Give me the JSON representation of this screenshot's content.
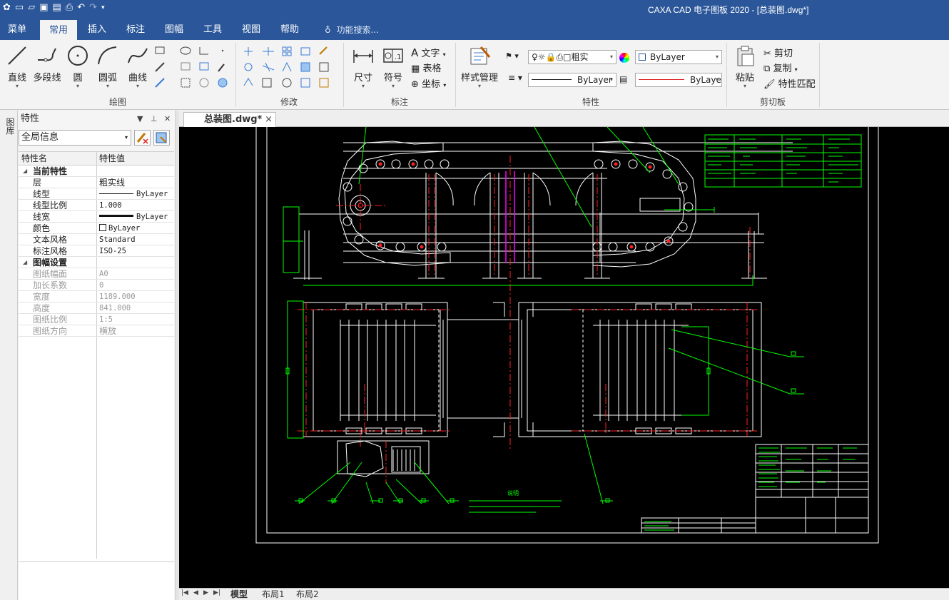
{
  "window": {
    "title": "CAXA CAD 电子图板 2020 - [总装图.dwg*]"
  },
  "quick_access": [
    "app-icon",
    "new-icon",
    "open-icon",
    "save-icon",
    "saveas-icon",
    "print-icon",
    "undo-icon",
    "redo-icon",
    "customize-icon"
  ],
  "menu": {
    "tabs": [
      "菜单",
      "常用",
      "插入",
      "标注",
      "图幅",
      "工具",
      "视图",
      "帮助"
    ],
    "active_tab": "常用",
    "search_placeholder": "功能搜索..."
  },
  "ribbon": {
    "draw": {
      "label": "绘图",
      "buttons": [
        "直线",
        "多段线",
        "圆",
        "圆弧",
        "曲线"
      ]
    },
    "modify": {
      "label": "修改"
    },
    "annotate": {
      "label": "标注",
      "buttons": [
        "尺寸",
        "符号"
      ],
      "small": [
        "文字",
        "表格",
        "坐标"
      ]
    },
    "props": {
      "label": "特性",
      "style_button": "样式管理",
      "layer_text": "粗实",
      "color_combo": "ByLayer",
      "linetype_combo": "ByLayer",
      "lineweight_combo": "ByLaye"
    },
    "clipboard": {
      "label": "剪切板",
      "paste": "粘贴",
      "cut": "剪切",
      "copy": "复制",
      "match": "特性匹配"
    }
  },
  "side_strip_label": "图库",
  "properties_panel": {
    "title": "特性",
    "selector": "全局信息",
    "col_name": "特性名",
    "col_value": "特性值",
    "section_current": "当前特性",
    "rows_current": [
      {
        "k": "层",
        "v": "粗实线"
      },
      {
        "k": "线型",
        "v": "ByLayer"
      },
      {
        "k": "线型比例",
        "v": "1.000"
      },
      {
        "k": "线宽",
        "v": "ByLayer"
      },
      {
        "k": "颜色",
        "v": "ByLayer"
      },
      {
        "k": "文本风格",
        "v": "Standard"
      },
      {
        "k": "标注风格",
        "v": "ISO-25"
      }
    ],
    "section_sheet": "图幅设置",
    "rows_sheet": [
      {
        "k": "图纸幅面",
        "v": "A0"
      },
      {
        "k": "加长系数",
        "v": "0"
      },
      {
        "k": "宽度",
        "v": "1189.000"
      },
      {
        "k": "高度",
        "v": "841.000"
      },
      {
        "k": "图纸比例",
        "v": "1:5"
      },
      {
        "k": "图纸方向",
        "v": "横放"
      }
    ]
  },
  "document": {
    "tab": "总装图.dwg*",
    "close": "×"
  },
  "drawing_notes": {
    "heading": "说明"
  },
  "layout_tabs": [
    "模型",
    "布局1",
    "布局2"
  ],
  "colors": {
    "brand": "#2b579a",
    "canvas": "#000000",
    "line_white": "#ffffff",
    "line_red": "#ff2020",
    "line_green": "#00ff00",
    "line_magenta": "#ff00ff"
  }
}
